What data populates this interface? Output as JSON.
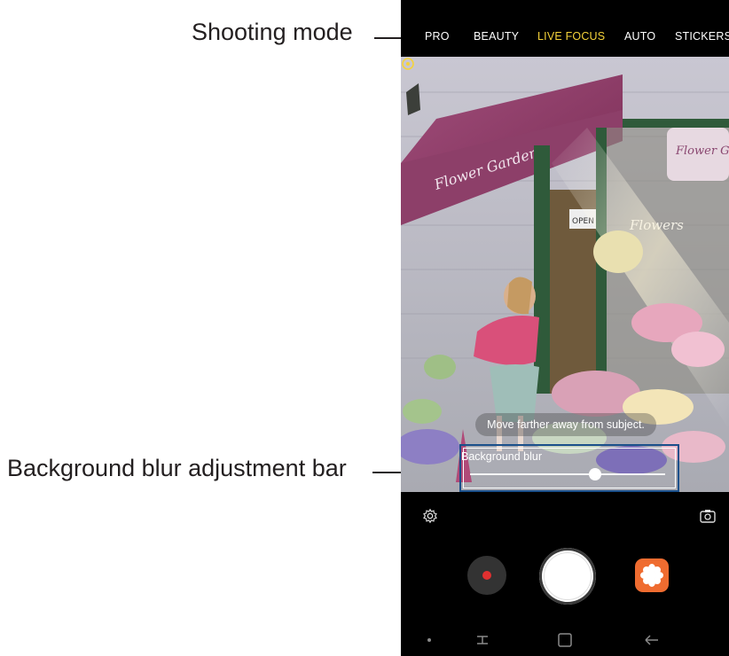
{
  "callouts": {
    "shooting_mode": "Shooting mode",
    "background_blur_bar": "Background blur adjustment bar"
  },
  "modes": [
    {
      "label": "PRO"
    },
    {
      "label": "BEAUTY"
    },
    {
      "label": "LIVE FOCUS"
    },
    {
      "label": "AUTO"
    },
    {
      "label": "STICKERS"
    }
  ],
  "active_mode": "LIVE FOCUS",
  "preview": {
    "hint": "Move farther away from subject.",
    "blur_label": "Background blur",
    "blur_level": 0.64,
    "sign_awning": "Flower Garden",
    "sign_window": "Flowers",
    "sign_hanging": "Flower Garden",
    "sign_open": "OPEN"
  },
  "controls": {
    "settings_icon": "gear-icon",
    "switch_camera_icon": "camera-switch-icon",
    "record_icon": "record-icon",
    "shutter_icon": "shutter-icon",
    "bixby_icon": "bixby-vision-icon"
  },
  "colors": {
    "active_mode": "#f5d33a",
    "callout_box": "#1a4f8a",
    "record_dot": "#e03030",
    "bixby": "#ef6c30"
  }
}
